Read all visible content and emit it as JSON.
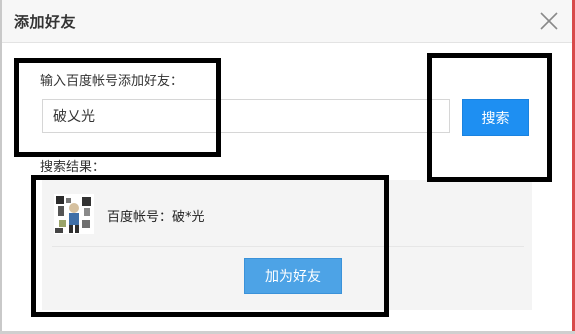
{
  "dialog": {
    "title": "添加好友"
  },
  "search": {
    "label": "输入百度帐号添加好友：",
    "value": "破乂光",
    "button_label": "搜索"
  },
  "results": {
    "label": "搜索结果：",
    "items": [
      {
        "account": "百度帐号：破*光",
        "add_button_label": "加为好友"
      }
    ]
  },
  "colors": {
    "primary_button": "#1e8ff2",
    "secondary_button": "#4da3e6",
    "annotation": "#000000"
  },
  "icons": {
    "close": "close-icon",
    "avatar": "avatar-image"
  }
}
